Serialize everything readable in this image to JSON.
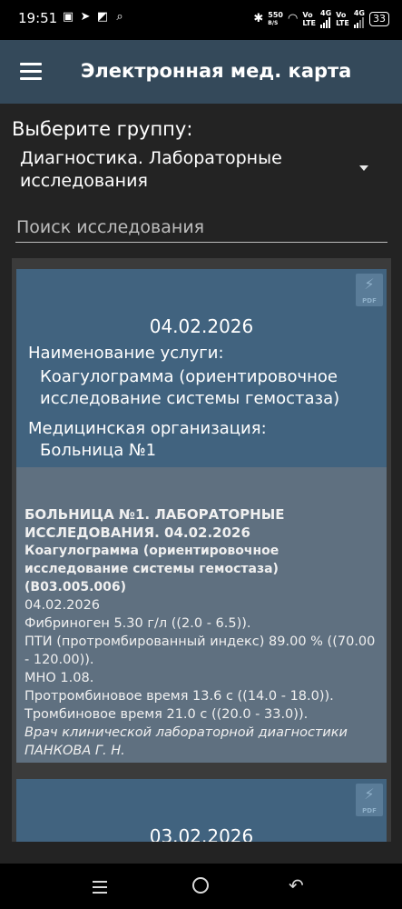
{
  "status_bar": {
    "time": "19:51",
    "net_speed_value": "550",
    "net_speed_unit": "B/S",
    "sim1_top": "Vo",
    "sim1_bottom": "LTE",
    "sim1_gen": "4G",
    "sim2_top": "Vo",
    "sim2_bottom": "LTE",
    "sim2_gen": "4G",
    "battery": "33"
  },
  "app_bar": {
    "title": "Электронная мед. карта"
  },
  "group": {
    "label": "Выберите группу:",
    "selected": "Диагностика. Лабораторные исследования"
  },
  "search": {
    "placeholder": "Поиск исследования",
    "value": ""
  },
  "records": [
    {
      "date": "04.02.2026",
      "pdf_label": "PDF",
      "service_label": "Наименование услуги:",
      "service_value": "Коагулограмма (ориентировочное исследование системы гемостаза)",
      "org_label": "Медицинская организация:",
      "org_value": "Больница №1",
      "details": {
        "title": "БОЛЬНИЦА №1. ЛАБОРАТОРНЫЕ ИССЛЕДОВАНИЯ. 04.02.2026",
        "subtitle": "Коагулограмма (ориентировочное исследование системы гемостаза) (B03.005.006)",
        "lines": [
          "04.02.2026",
          "Фибриноген 5.30 г/л ((2.0 - 6.5)).",
          "ПТИ (протромбированный индекс) 89.00 % ((70.00 - 120.00)).",
          "МНО 1.08.",
          "Протромбиновое время 13.6 с ((14.0 - 18.0)).",
          "Тромбиновое время 21.0 с ((20.0 - 33.0))."
        ],
        "doctor": "Врач клинической лабораторной диагностики ПАНКОВА Г. Н."
      }
    },
    {
      "date": "03.02.2026",
      "pdf_label": "PDF"
    }
  ],
  "icons": {
    "menu": "hamburger-menu-icon",
    "dropdown": "dropdown-arrow-icon",
    "pdf": "pdf-file-icon",
    "nav_recents": "recents-icon",
    "nav_home": "home-icon",
    "nav_back": "back-icon"
  },
  "colors": {
    "app_bar": "#34495a",
    "card_header": "#41637f",
    "card_body": "#5f7080",
    "background": "#232323"
  }
}
